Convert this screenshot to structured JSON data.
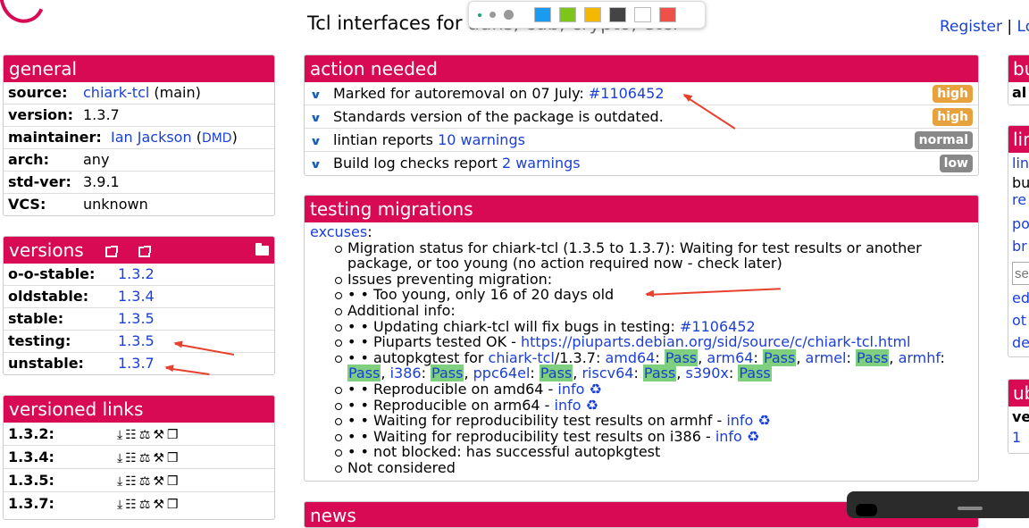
{
  "header": {
    "title_visible": "Tcl interfaces for ",
    "title_hidden": "adns, cdb, crypto, etc.",
    "register": "Register",
    "separator": "|",
    "login": "Lo"
  },
  "toolbar": {
    "tools": [
      "small-dot",
      "medium-dot",
      "large-dot"
    ],
    "colors": [
      "#1a9bf0",
      "#7cc51b",
      "#f5b800",
      "#444444",
      "#ffffff",
      "#f0504a"
    ]
  },
  "general": {
    "title": "general",
    "source_label": "source:",
    "source_value": "chiark-tcl",
    "source_suffix": " (main)",
    "version_label": "version:",
    "version_value": "1.3.7",
    "maintainer_label": "maintainer:",
    "maintainer_value": "Ian Jackson",
    "maintainer_open": " (",
    "maintainer_dmd": "DMD",
    "maintainer_close": ")",
    "arch_label": "arch:",
    "arch_value": "any",
    "stdver_label": "std-ver:",
    "stdver_value": "3.9.1",
    "vcs_label": "VCS:",
    "vcs_value": "unknown"
  },
  "versions": {
    "title": "versions",
    "rows": [
      {
        "label": "o-o-stable:",
        "value": "1.3.2"
      },
      {
        "label": "oldstable:",
        "value": "1.3.4"
      },
      {
        "label": "stable:",
        "value": "1.3.5"
      },
      {
        "label": "testing:",
        "value": "1.3.5"
      },
      {
        "label": "unstable:",
        "value": "1.3.7"
      }
    ]
  },
  "versioned_links": {
    "title": "versioned links",
    "rows": [
      {
        "label": "1.3.2:"
      },
      {
        "label": "1.3.4:"
      },
      {
        "label": "1.3.5:"
      },
      {
        "label": "1.3.7:"
      }
    ],
    "icon_glyphs": [
      "⤓",
      "☷",
      "⚖",
      "⚒",
      "❒"
    ]
  },
  "action_needed": {
    "title": "action needed",
    "items": [
      {
        "prefix": "Marked for autoremoval on 07 July: ",
        "link": "#1106452",
        "suffix": "",
        "badge": "high",
        "badge_color": "#e8a23d"
      },
      {
        "prefix": "Standards version of the package is outdated.",
        "link": "",
        "suffix": "",
        "badge": "high",
        "badge_color": "#e8a23d"
      },
      {
        "prefix": "lintian reports ",
        "link": "10 warnings",
        "suffix": "",
        "badge": "normal",
        "badge_color": "#888888"
      },
      {
        "prefix": "Build log checks report ",
        "link": "2 warnings",
        "suffix": "",
        "badge": "low",
        "badge_color": "#888888"
      }
    ]
  },
  "testing_migrations": {
    "title": "testing migrations",
    "excuses": "excuses",
    "colon": ":",
    "status": "Migration status for chiark-tcl (1.3.5 to 1.3.7): Waiting for test results or another package, or too young (no action required now - check later)",
    "issues": "Issues preventing migration:",
    "too_young": "• • Too young, only 16 of 20 days old",
    "additional": "Additional info:",
    "updating_prefix": "• • Updating chiark-tcl will fix bugs in testing: ",
    "updating_link": "#1106452",
    "piuparts_prefix": "• • Piuparts tested OK - ",
    "piuparts_link": "https://piuparts.debian.org/sid/source/c/chiark-tcl.html",
    "autopkg_prefix": "• • autopkgtest for ",
    "autopkg_pkg": "chiark-tcl",
    "autopkg_ver": "/1.3.7: ",
    "arches": [
      "amd64",
      "arm64",
      "armel",
      "armhf",
      "i386",
      "ppc64el",
      "riscv64",
      "s390x"
    ],
    "pass": "Pass",
    "repro_amd64": "• • Reproducible on amd64 - ",
    "repro_arm64": "• • Reproducible on arm64 - ",
    "wait_armhf": "• • Waiting for reproducibility test results on armhf - ",
    "wait_i386": "• • Waiting for reproducibility test results on i386 - ",
    "info": "info",
    "recycle": "♻",
    "not_blocked": "• • not blocked: has successful autopkgtest",
    "not_considered": "Not considered"
  },
  "news": {
    "title": "news"
  },
  "right_col": {
    "box1_title": "bu",
    "box1_line": "al",
    "box2_title": "lin",
    "box2_lines": [
      "lin",
      "bu",
      "re",
      "po",
      "br"
    ],
    "search_placeholder": "se",
    "box2_links": [
      "ed",
      "ot",
      "de"
    ],
    "box3_title": "ub",
    "box3_bold": "ve",
    "box3_line": "1"
  }
}
